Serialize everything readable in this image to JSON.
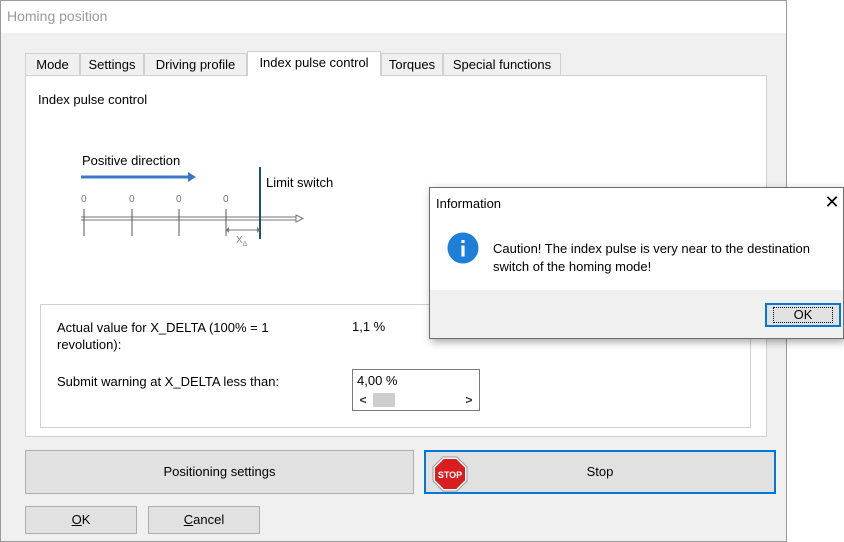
{
  "window": {
    "title": "Homing position"
  },
  "tabs": [
    {
      "label": "Mode"
    },
    {
      "label": "Settings"
    },
    {
      "label": "Driving profile"
    },
    {
      "label": "Index pulse control"
    },
    {
      "label": "Torques"
    },
    {
      "label": "Special functions"
    }
  ],
  "active_tab": "Index pulse control",
  "panel": {
    "title": "Index pulse control",
    "diagram": {
      "direction_label": "Positive direction",
      "limit_label": "Limit switch",
      "tick_labels": [
        "0",
        "0",
        "0",
        "0"
      ],
      "delta_label": "X",
      "delta_subscript": "Δ"
    },
    "actual_label": "Actual value for X_DELTA (100% = 1 revolution):",
    "actual_value": "1,1 %",
    "warn_label": "Submit warning at X_DELTA less than:",
    "warn_value": "4,00 %",
    "scroll_left": "<",
    "scroll_right": ">"
  },
  "buttons": {
    "positioning": "Positioning settings",
    "stop": "Stop",
    "stop_icon_text": "STOP",
    "ok_mnemonic": "O",
    "ok_rest": "K",
    "cancel_mnemonic": "C",
    "cancel_rest": "ancel"
  },
  "dialog": {
    "title": "Information",
    "close": "✕",
    "message": "Caution! The index pulse is very near to the destination switch of the homing mode!",
    "ok": "OK",
    "icon": "info-icon"
  },
  "colors": {
    "accent": "#0078d7",
    "stop_red": "#d81e1e",
    "diagram_blue": "#3c78c8"
  }
}
